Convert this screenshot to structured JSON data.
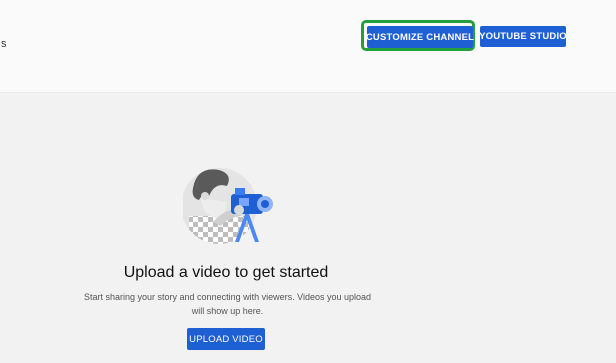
{
  "header": {
    "edge_text": "s",
    "customize_label": "CUSTOMIZE CHANNEL",
    "studio_label": "YOUTUBE STUDIO"
  },
  "empty_state": {
    "title": "Upload a video to get started",
    "description": "Start sharing your story and connecting with viewers. Videos you upload will show up here.",
    "upload_label": "UPLOAD VIDEO",
    "illustration_icon": "person-with-video-camera-icon"
  },
  "colors": {
    "button_blue": "#1f5fd4",
    "highlight_green": "#23a03c"
  }
}
